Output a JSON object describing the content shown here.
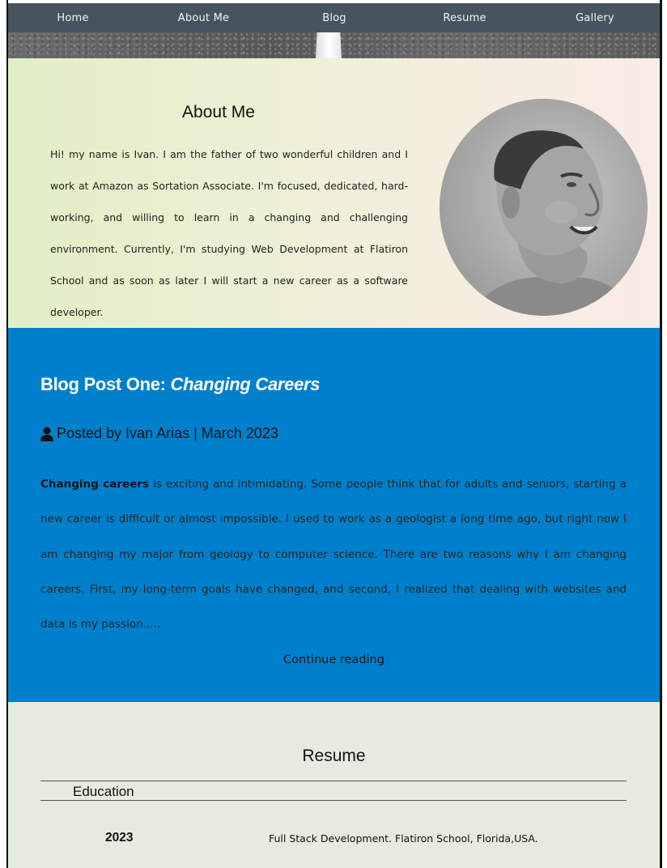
{
  "nav": {
    "items": [
      {
        "label": "Home"
      },
      {
        "label": "About Me"
      },
      {
        "label": "Blog"
      },
      {
        "label": "Resume"
      },
      {
        "label": "Gallery"
      }
    ]
  },
  "about": {
    "title": "About Me",
    "text": "Hi! my name is Ivan. I am the father of two wonderful children and I work at Amazon as Sortation Associate. I'm focused, dedicated, hard-working, and willing to learn in a changing and challenging environment. Currently, I'm studying Web Development at Flatiron School and as soon as later I will start a new career as a software developer."
  },
  "blog": {
    "title_prefix": "Blog Post One: ",
    "title_italic": "Changing Careers",
    "byline": "Posted by Ivan Arias | March 2023",
    "lead_bold": "Changing careers",
    "body": " is exciting and intimidating. Some people think that for adults and seniors, starting a new career is difficult or almost impossible. I used to work as a geologist a long time ago, but right now I am changing my major from geology to computer science. There are two reasons why I am changing careers. First, my long-term goals have changed, and second, I realized that dealing with websites and data is my passion.....",
    "continue_label": "Continue reading"
  },
  "resume": {
    "title": "Resume",
    "education_label": "Education",
    "rows": [
      {
        "year": "2023",
        "description": "Full Stack Development. Flatiron School, Florida,USA."
      }
    ]
  },
  "colors": {
    "nav_bg": "#465460",
    "blog_bg": "#0080cc",
    "resume_bg": "#e6ebe0"
  }
}
